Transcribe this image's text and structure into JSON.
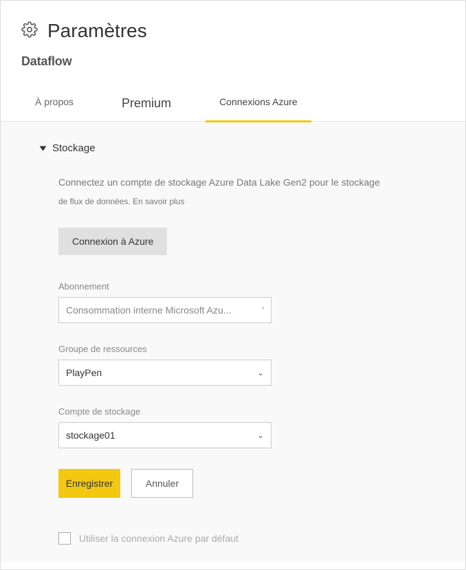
{
  "header": {
    "title": "Paramètres",
    "subtitle": "Dataflow"
  },
  "tabs": {
    "about": "À propos",
    "premium": "Premium",
    "azure": "Connexions Azure"
  },
  "storage": {
    "title": "Stockage",
    "desc_line1": "Connectez un compte de stockage Azure Data Lake Gen2 pour le stockage",
    "desc_line2": "de flux de données. En savoir plus",
    "connect_button": "Connexion à Azure",
    "subscription_label": "Abonnement",
    "subscription_value": "Consommation interne Microsoft Azu...",
    "resource_group_label": "Groupe de ressources",
    "resource_group_value": "PlayPen",
    "storage_account_label": "Compte de stockage",
    "storage_account_value": "stockage01",
    "save_label": "Enregistrer",
    "cancel_label": "Annuler",
    "default_checkbox_label": "Utiliser la connexion Azure par défaut"
  }
}
